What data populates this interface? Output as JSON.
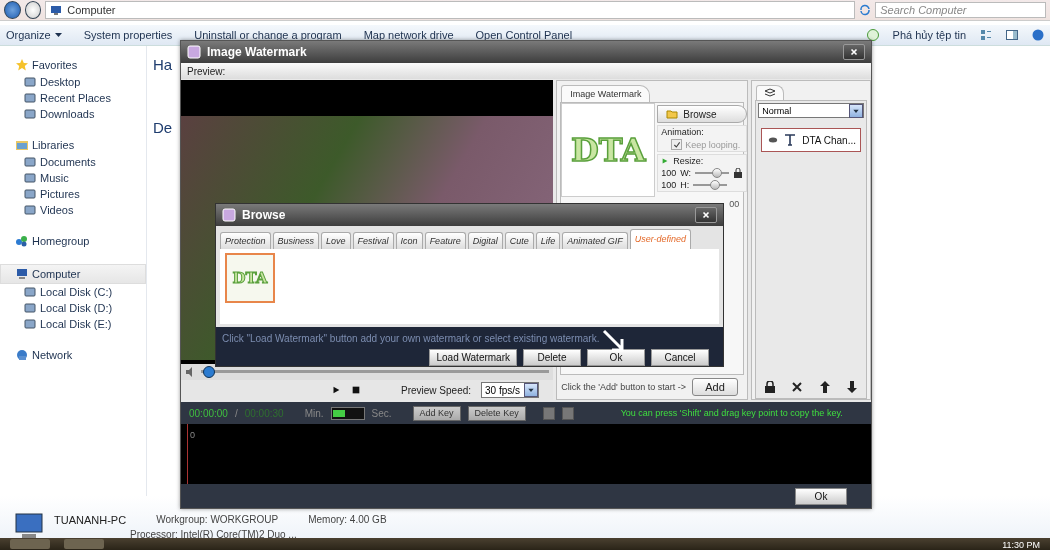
{
  "explorer": {
    "crumb": "Computer",
    "search": {
      "placeholder": "Search Computer"
    },
    "toolbar": [
      "Organize",
      "System properties",
      "Uninstall or change a program",
      "Map network drive",
      "Open Control Panel"
    ],
    "toolbar_right": "Phá hủy tệp tin",
    "sidebar": [
      {
        "label": "Favorites",
        "selected": false,
        "children": [
          {
            "label": "Desktop",
            "selected": false
          },
          {
            "label": "Recent Places",
            "selected": false
          },
          {
            "label": "Downloads",
            "selected": false
          }
        ]
      },
      {
        "label": "Libraries",
        "selected": false,
        "children": [
          {
            "label": "Documents",
            "selected": false
          },
          {
            "label": "Music",
            "selected": false
          },
          {
            "label": "Pictures",
            "selected": false
          },
          {
            "label": "Videos",
            "selected": false
          }
        ]
      },
      {
        "label": "Homegroup",
        "selected": false
      },
      {
        "label": "Computer",
        "selected": true,
        "children": [
          {
            "label": "Local Disk (C:)",
            "selected": false
          },
          {
            "label": "Local Disk (D:)",
            "selected": false
          },
          {
            "label": "Local Disk (E:)",
            "selected": false
          }
        ]
      },
      {
        "label": "Network",
        "selected": false
      }
    ],
    "sections": [
      "Ha",
      "De"
    ],
    "details": {
      "name": "TUANANH-PC",
      "workgroup": "Workgroup: WORKGROUP",
      "memory": "Memory: 4.00 GB",
      "processor": "Processor: Intel(R) Core(TM)2 Duo ..."
    }
  },
  "taskbar": {
    "clock": "11:30 PM"
  },
  "watermark_window": {
    "title": "Image Watermark",
    "preview_label": "Preview:",
    "position": {
      "level": 0.02
    },
    "speed_label": "Preview Speed:",
    "speed": "30 fps/s",
    "properties": {
      "tab": "Image Watermark",
      "logo": "DTA",
      "browse": "Browse",
      "animation_label": "Animation:",
      "keep_looping": {
        "label": "Keep looping.",
        "checked": true,
        "disabled": true
      },
      "resize_label": "Resize:",
      "resize": [
        {
          "value": "100",
          "axis": "W:",
          "level": 0.6
        },
        {
          "value": "100",
          "axis": "H:",
          "level": 0.6
        }
      ],
      "hidden_value": "00",
      "add_hint": "Click the 'Add' button to start ->",
      "add": "Add"
    },
    "layers": {
      "blend": "Normal",
      "items": [
        {
          "name": "DTA Chan...",
          "visible": true,
          "selected": true
        }
      ]
    },
    "timeline": {
      "current": "00:00:00",
      "separator": "/",
      "total": "00:00:30",
      "min": "Min.",
      "unit_toggle": {
        "on": true
      },
      "sec": "Sec.",
      "add_key": {
        "label": "Add Key",
        "disabled": true
      },
      "delete_key": {
        "label": "Delete Key",
        "disabled": true
      },
      "hint": "You can press 'Shift' and drag key point to copy the key.",
      "ruler": "0"
    },
    "ok": "Ok"
  },
  "browse_dialog": {
    "title": "Browse",
    "tabs": [
      {
        "label": "Protection",
        "selected": false
      },
      {
        "label": "Business",
        "selected": false
      },
      {
        "label": "Love",
        "selected": false
      },
      {
        "label": "Festival",
        "selected": false
      },
      {
        "label": "Icon",
        "selected": false
      },
      {
        "label": "Feature",
        "selected": false
      },
      {
        "label": "Digital",
        "selected": false
      },
      {
        "label": "Cute",
        "selected": false
      },
      {
        "label": "Life",
        "selected": false
      },
      {
        "label": "Animated GIF",
        "selected": false
      },
      {
        "label": "User-defined",
        "selected": true
      }
    ],
    "thumbnails": [
      {
        "text": "DTA",
        "selected": true
      }
    ],
    "hint": "Click \"Load Watermark\" button add your own watermark or select existing watermark.",
    "buttons": [
      "Load Watermark",
      "Delete",
      "Ok",
      "Cancel"
    ]
  }
}
